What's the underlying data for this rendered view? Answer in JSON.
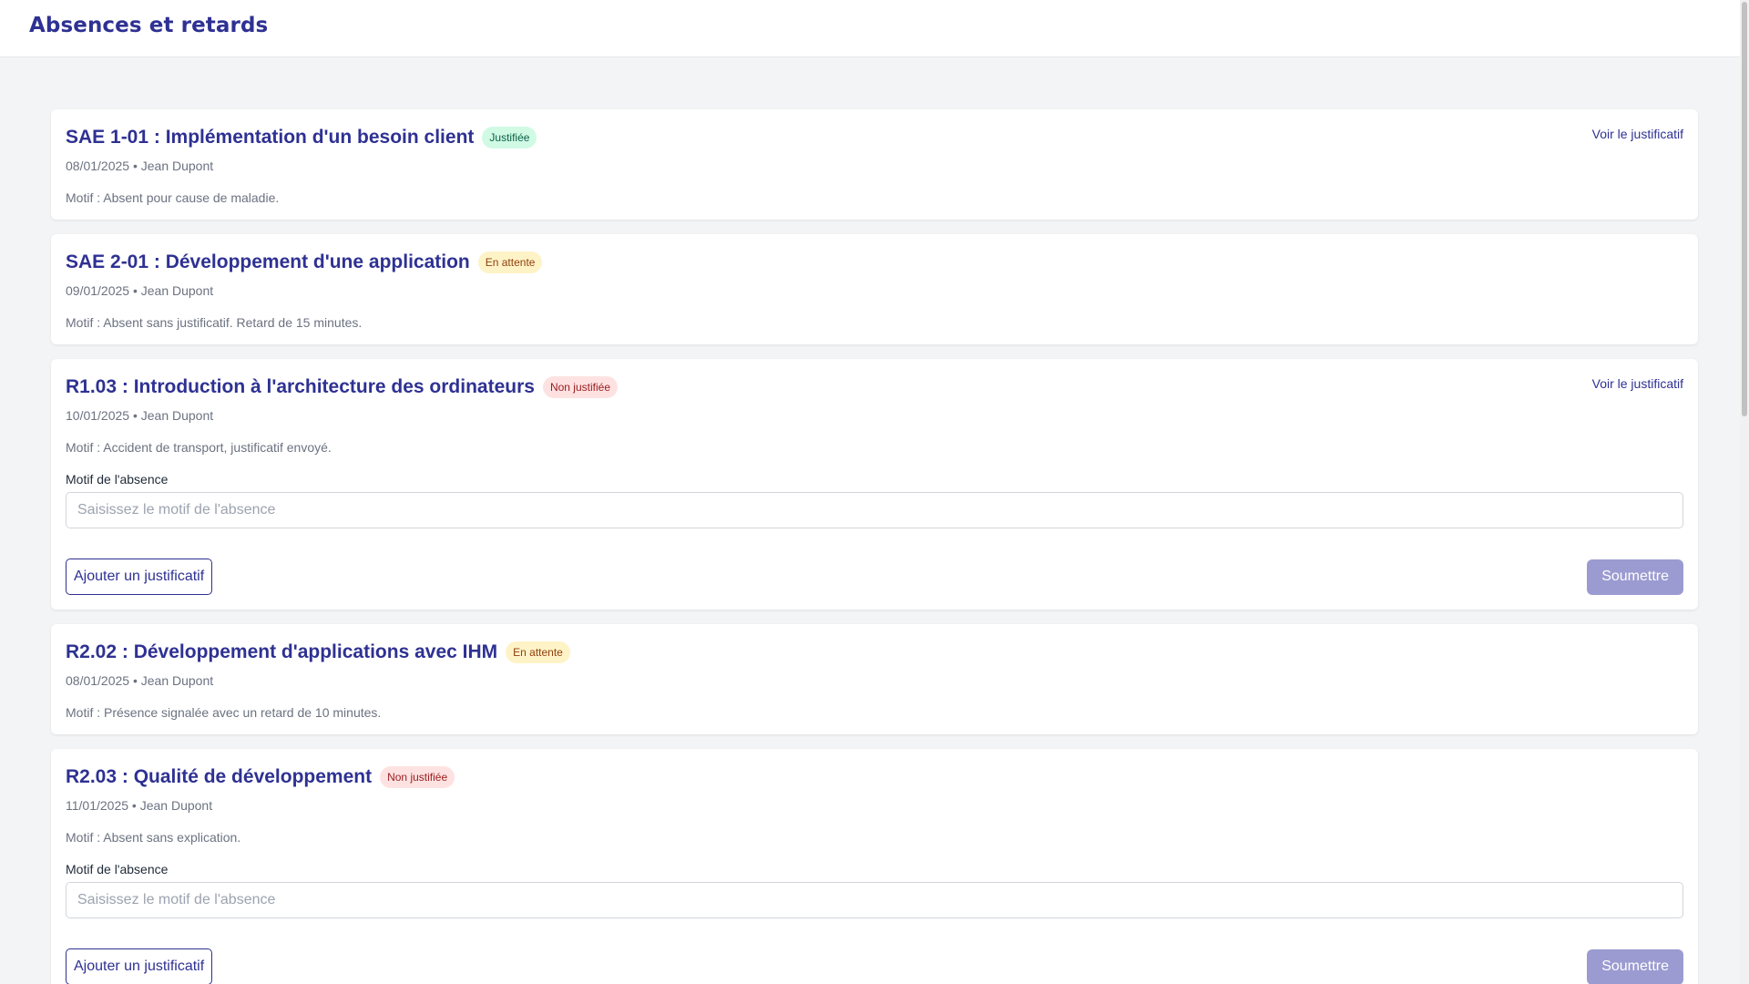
{
  "header": {
    "title": "Absences et retards"
  },
  "cards": [
    {
      "title": "SAE 1-01 : Implémentation d'un besoin client",
      "status": "Justifiée",
      "date_author": "08/01/2025 • Jean Dupont",
      "motif": "Motif : Absent pour cause de maladie.",
      "link": "Voir le justificatif"
    },
    {
      "title": "SAE 2-01 : Développement d'une application",
      "status": "En attente",
      "date_author": "09/01/2025 • Jean Dupont",
      "motif": "Motif : Absent sans justificatif. Retard de 15 minutes."
    },
    {
      "title": "R1.03 : Introduction à l'architecture des ordinateurs",
      "status": "Non justifiée",
      "date_author": "10/01/2025 • Jean Dupont",
      "motif": "Motif : Accident de transport, justificatif envoyé.",
      "link": "Voir le justificatif",
      "form": {
        "label": "Motif de l'absence",
        "placeholder": "Saisissez le motif de l'absence",
        "add_button": "Ajouter un justificatif",
        "submit_button": "Soumettre"
      }
    },
    {
      "title": "R2.02 : Développement d'applications avec IHM",
      "status": "En attente",
      "date_author": "08/01/2025 • Jean Dupont",
      "motif": "Motif : Présence signalée avec un retard de 10 minutes."
    },
    {
      "title": "R2.03 : Qualité de développement",
      "status": "Non justifiée",
      "date_author": "11/01/2025 • Jean Dupont",
      "motif": "Motif : Absent sans explication.",
      "form": {
        "label": "Motif de l'absence",
        "placeholder": "Saisissez le motif de l'absence",
        "add_button": "Ajouter un justificatif",
        "submit_button": "Soumettre"
      }
    }
  ],
  "colors": {
    "brand": "#2e3192",
    "badge_justifiee": "#d1fae5",
    "badge_attente": "#fef3c7",
    "badge_non_justifiee": "#fee2e2",
    "submit_disabled": "#9b9bd1"
  }
}
